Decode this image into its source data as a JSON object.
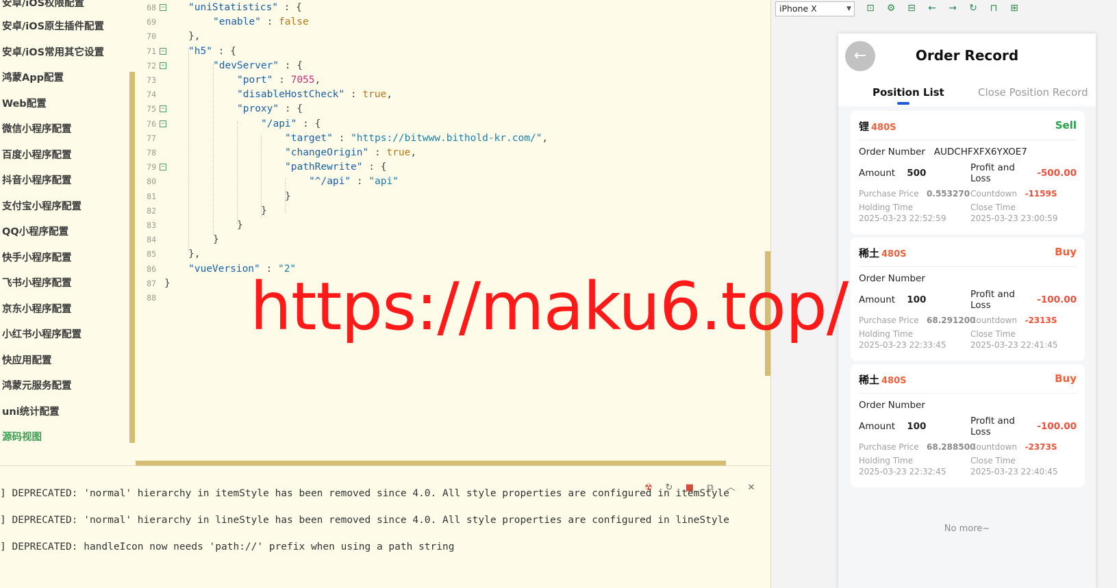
{
  "sidebar": {
    "items": [
      {
        "label": "安卓/iOS权限配置"
      },
      {
        "label": "安卓/iOS原生插件配置"
      },
      {
        "label": "安卓/iOS常用其它设置"
      },
      {
        "label": "鸿蒙App配置"
      },
      {
        "label": "Web配置"
      },
      {
        "label": "微信小程序配置"
      },
      {
        "label": "百度小程序配置"
      },
      {
        "label": "抖音小程序配置"
      },
      {
        "label": "支付宝小程序配置"
      },
      {
        "label": "QQ小程序配置"
      },
      {
        "label": "快手小程序配置"
      },
      {
        "label": "飞书小程序配置"
      },
      {
        "label": "京东小程序配置"
      },
      {
        "label": "小红书小程序配置"
      },
      {
        "label": "快应用配置"
      },
      {
        "label": "鸿蒙元服务配置"
      },
      {
        "label": "uni统计配置"
      },
      {
        "label": "源码视图"
      }
    ]
  },
  "editor": {
    "lines": [
      {
        "no": "68",
        "fold": "⊟",
        "parts": [
          {
            "t": "\"uniStatistics\"",
            "c": "k"
          },
          {
            "t": " : {",
            "c": "p"
          }
        ]
      },
      {
        "no": "69",
        "fold": "",
        "parts": [
          {
            "t": "\"enable\"",
            "c": "k"
          },
          {
            "t": " : ",
            "c": "p"
          },
          {
            "t": "false",
            "c": "b"
          }
        ]
      },
      {
        "no": "70",
        "fold": "",
        "parts": [
          {
            "t": "},",
            "c": "p"
          }
        ]
      },
      {
        "no": "71",
        "fold": "⊟",
        "parts": [
          {
            "t": "\"h5\"",
            "c": "k"
          },
          {
            "t": " : {",
            "c": "p"
          }
        ]
      },
      {
        "no": "72",
        "fold": "⊟",
        "parts": [
          {
            "t": "\"devServer\"",
            "c": "k"
          },
          {
            "t": " : {",
            "c": "p"
          }
        ]
      },
      {
        "no": "73",
        "fold": "",
        "parts": [
          {
            "t": "\"port\"",
            "c": "k"
          },
          {
            "t": " : ",
            "c": "p"
          },
          {
            "t": "7055",
            "c": "n"
          },
          {
            "t": ",",
            "c": "p"
          }
        ]
      },
      {
        "no": "74",
        "fold": "",
        "parts": [
          {
            "t": "\"disableHostCheck\"",
            "c": "k"
          },
          {
            "t": " : ",
            "c": "p"
          },
          {
            "t": "true",
            "c": "b"
          },
          {
            "t": ",",
            "c": "p"
          }
        ]
      },
      {
        "no": "75",
        "fold": "⊟",
        "parts": [
          {
            "t": "\"proxy\"",
            "c": "k"
          },
          {
            "t": " : {",
            "c": "p"
          }
        ]
      },
      {
        "no": "76",
        "fold": "⊟",
        "parts": [
          {
            "t": "\"/api\"",
            "c": "k"
          },
          {
            "t": " : {",
            "c": "p"
          }
        ]
      },
      {
        "no": "77",
        "fold": "",
        "parts": [
          {
            "t": "\"target\"",
            "c": "k"
          },
          {
            "t": " : ",
            "c": "p"
          },
          {
            "t": "\"https://bitwww.bithold-kr.com/\"",
            "c": "s"
          },
          {
            "t": ",",
            "c": "p"
          }
        ]
      },
      {
        "no": "78",
        "fold": "",
        "parts": [
          {
            "t": "\"changeOrigin\"",
            "c": "k"
          },
          {
            "t": " : ",
            "c": "p"
          },
          {
            "t": "true",
            "c": "b"
          },
          {
            "t": ",",
            "c": "p"
          }
        ]
      },
      {
        "no": "79",
        "fold": "⊟",
        "parts": [
          {
            "t": "\"pathRewrite\"",
            "c": "k"
          },
          {
            "t": " : {",
            "c": "p"
          }
        ]
      },
      {
        "no": "80",
        "fold": "",
        "parts": [
          {
            "t": "\"^/api\"",
            "c": "k"
          },
          {
            "t": " : ",
            "c": "p"
          },
          {
            "t": "\"api\"",
            "c": "s"
          }
        ]
      },
      {
        "no": "81",
        "fold": "",
        "parts": [
          {
            "t": "}",
            "c": "p"
          }
        ]
      },
      {
        "no": "82",
        "fold": "",
        "parts": [
          {
            "t": "}",
            "c": "p"
          }
        ]
      },
      {
        "no": "83",
        "fold": "",
        "parts": [
          {
            "t": "}",
            "c": "p"
          }
        ]
      },
      {
        "no": "84",
        "fold": "",
        "parts": [
          {
            "t": "}",
            "c": "p"
          }
        ]
      },
      {
        "no": "85",
        "fold": "",
        "parts": [
          {
            "t": "},",
            "c": "p"
          }
        ]
      },
      {
        "no": "86",
        "fold": "",
        "parts": [
          {
            "t": "\"vueVersion\"",
            "c": "k"
          },
          {
            "t": " : ",
            "c": "p"
          },
          {
            "t": "\"2\"",
            "c": "s"
          }
        ]
      },
      {
        "no": "87",
        "fold": "",
        "parts": [
          {
            "t": "}",
            "c": "p"
          }
        ]
      },
      {
        "no": "88",
        "fold": "",
        "parts": []
      }
    ]
  },
  "console": {
    "lines": [
      "] DEPRECATED: 'normal' hierarchy in itemStyle has been removed since 4.0. All style properties are configured in itemStyle",
      "] DEPRECATED: 'normal' hierarchy in lineStyle has been removed since 4.0. All style properties are configured in lineStyle",
      "] DEPRECATED: handleIcon now needs 'path://' prefix when using a path string"
    ]
  },
  "simulator": {
    "device": "iPhone X"
  },
  "phone": {
    "title": "Order Record",
    "tabs": {
      "active": "Position List",
      "inactive": "Close Position Record"
    },
    "labels": {
      "order_number": "Order Number",
      "amount": "Amount",
      "profit_and_loss": "Profit and\nLoss",
      "purchase_price": "Purchase Price",
      "countdown": "Countdown",
      "holding_time": "Holding Time",
      "close_time": "Close Time"
    },
    "cards": [
      {
        "name": "锂",
        "price": "480S",
        "side": "Sell",
        "order_number": "AUDCHFXFX6YXOE7",
        "amount": "500",
        "pnl": "-500.00",
        "purchase_price": "0.553270",
        "countdown": "-1159S",
        "holding_time": "2025-03-23 22:52:59",
        "close_time": "2025-03-23 23:00:59"
      },
      {
        "name": "稀土",
        "price": "480S",
        "side": "Buy",
        "order_number": "",
        "amount": "100",
        "pnl": "-100.00",
        "purchase_price": "68.291200",
        "countdown": "-2313S",
        "holding_time": "2025-03-23 22:33:45",
        "close_time": "2025-03-23 22:41:45"
      },
      {
        "name": "稀土",
        "price": "480S",
        "side": "Buy",
        "order_number": "",
        "amount": "100",
        "pnl": "-100.00",
        "purchase_price": "68.288500",
        "countdown": "-2373S",
        "holding_time": "2025-03-23 22:32:45",
        "close_time": "2025-03-23 22:40:45"
      }
    ],
    "no_more": "No more~"
  },
  "watermark": "https://maku6.top/"
}
